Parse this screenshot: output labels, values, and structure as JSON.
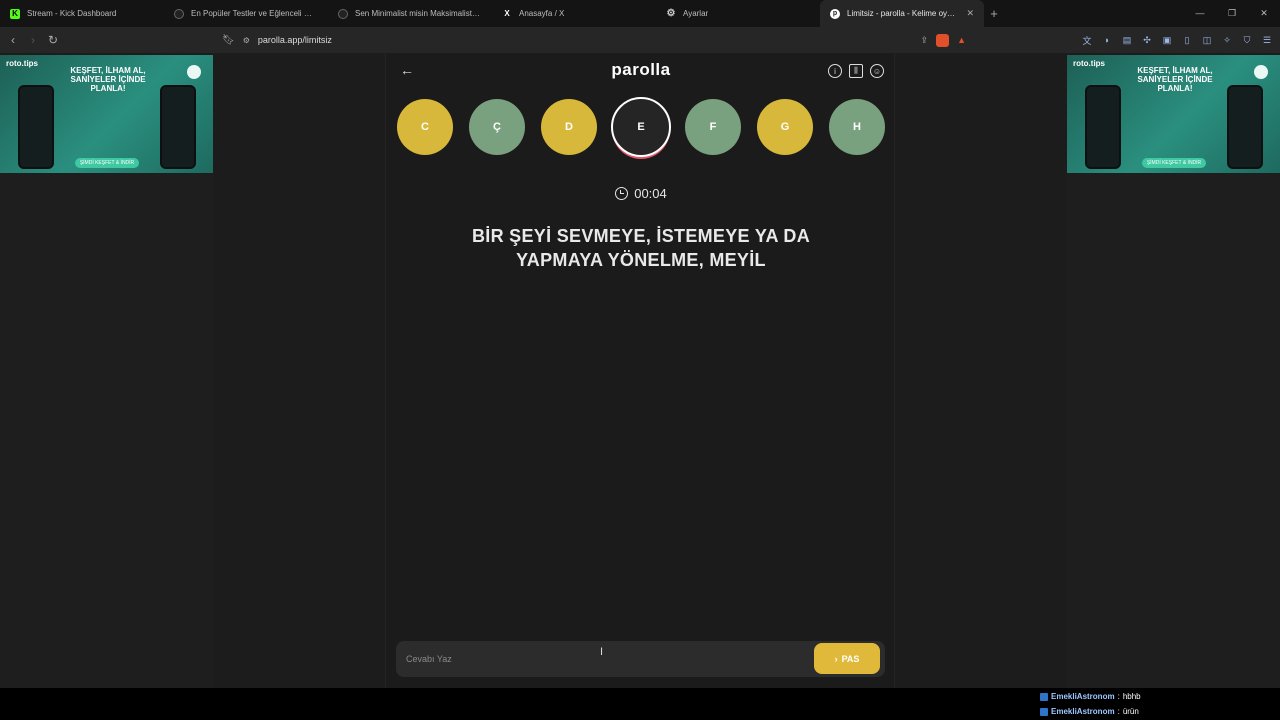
{
  "tabs": [
    {
      "label": "Stream - Kick Dashboard",
      "icon": "kick-icon",
      "active": false
    },
    {
      "label": "En Popüler Testler ve Eğlenceli Quizler",
      "icon": "quiz-icon",
      "active": false
    },
    {
      "label": "Sen Minimalist misin Maksimalist mi?",
      "icon": "quiz-icon",
      "active": false
    },
    {
      "label": "Anasayfa / X",
      "icon": "x-icon",
      "active": false
    },
    {
      "label": "Ayarlar",
      "icon": "gear-icon",
      "active": false
    },
    {
      "label": "Limitsiz - parolla - Kelime oyunu",
      "icon": "parolla-icon",
      "active": true
    }
  ],
  "address": {
    "url": "parolla.app/limitsiz"
  },
  "ad": {
    "brand": "roto.tips",
    "headline": "KEŞFET, İLHAM AL, SANİYELER İÇİNDE PLANLA!",
    "cta": "ŞİMDİ KEŞFET & İNDİR"
  },
  "game": {
    "logo": "parolla",
    "letters": [
      {
        "char": "C",
        "state": "yellow"
      },
      {
        "char": "Ç",
        "state": "green"
      },
      {
        "char": "D",
        "state": "yellow"
      },
      {
        "char": "E",
        "state": "current"
      },
      {
        "char": "F",
        "state": "green"
      },
      {
        "char": "G",
        "state": "yellow"
      },
      {
        "char": "H",
        "state": "green"
      }
    ],
    "timer": "00:04",
    "question": "BİR ŞEYİ SEVMEYE, İSTEMEYE YA DA YAPMAYA YÖNELME, MEYİL",
    "answer_placeholder": "Cevabı Yaz",
    "pass_label": "PAS"
  },
  "chat": [
    {
      "user": "EmekliAstronom",
      "message": "hbhb"
    },
    {
      "user": "EmekliAstronom",
      "message": "ürün"
    }
  ],
  "colors": {
    "yellow": "#d8b83a",
    "green": "#7aa17f",
    "accent": "#e1b93a"
  }
}
